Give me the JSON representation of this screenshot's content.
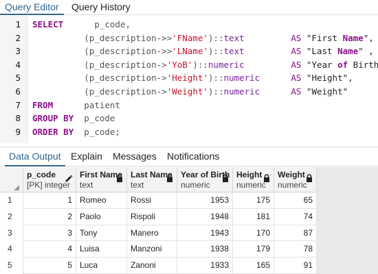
{
  "top_tabs": [
    {
      "label": "Query Editor",
      "active": true
    },
    {
      "label": "Query History",
      "active": false
    }
  ],
  "editor": {
    "line_numbers": [
      "1",
      "2",
      "3",
      "4",
      "5",
      "6",
      "7",
      "8",
      "9"
    ],
    "lines": [
      {
        "kw": "SELECT",
        "rest": "p_code,"
      },
      {
        "expr_open": "(p_description->>",
        "key": "'FName'",
        "expr_close": ")::",
        "type": "text",
        "as": "AS",
        "alias_pre": "\"First ",
        "alias_kw": "Name",
        "alias_post": "\","
      },
      {
        "expr_open": "(p_description->>",
        "key": "'LName'",
        "expr_close": ")::",
        "type": "text",
        "as": "AS",
        "alias_pre": "\"Last ",
        "alias_kw": "Name",
        "alias_post": "\" ,"
      },
      {
        "expr_open": "(p_description->",
        "key": "'YoB'",
        "expr_close": ")::",
        "type": "numeric",
        "as": "AS",
        "alias_pre": "\"Year ",
        "alias_kw": "of",
        "alias_post": " Birth\","
      },
      {
        "expr_open": "(p_description->",
        "key": "'Height'",
        "expr_close": ")::",
        "type": "numeric",
        "as": "AS",
        "alias_pre": "\"Height\",",
        "alias_kw": "",
        "alias_post": ""
      },
      {
        "expr_open": "(p_description->",
        "key": "'Weight'",
        "expr_close": ")::",
        "type": "numeric",
        "as": "AS",
        "alias_pre": "\"Weight\"",
        "alias_kw": "",
        "alias_post": ""
      },
      {
        "kw": "FROM",
        "rest": "patient"
      },
      {
        "kw": "GROUP BY",
        "rest": "p_code"
      },
      {
        "kw": "ORDER BY",
        "rest": "p_code;"
      }
    ]
  },
  "output_tabs": [
    {
      "label": "Data Output",
      "active": true
    },
    {
      "label": "Explain",
      "active": false
    },
    {
      "label": "Messages",
      "active": false
    },
    {
      "label": "Notifications",
      "active": false
    }
  ],
  "grid": {
    "columns": [
      {
        "name": "p_code",
        "type": "[PK] integer",
        "icon": "pencil-icon"
      },
      {
        "name": "First Name",
        "type": "text",
        "icon": "lock-icon"
      },
      {
        "name": "Last Name",
        "type": "text",
        "icon": "lock-icon"
      },
      {
        "name": "Year of Birth",
        "type": "numeric",
        "icon": "lock-icon"
      },
      {
        "name": "Height",
        "type": "numeric",
        "icon": "lock-icon"
      },
      {
        "name": "Weight",
        "type": "numeric",
        "icon": "lock-icon"
      }
    ],
    "rows": [
      {
        "n": "1",
        "cells": [
          "1",
          "Romeo",
          "Rossi",
          "1953",
          "175",
          "65"
        ]
      },
      {
        "n": "2",
        "cells": [
          "2",
          "Paolo",
          "Rispoli",
          "1948",
          "181",
          "74"
        ]
      },
      {
        "n": "3",
        "cells": [
          "3",
          "Tony",
          "Manero",
          "1943",
          "170",
          "87"
        ]
      },
      {
        "n": "4",
        "cells": [
          "4",
          "Luisa",
          "Manzoni",
          "1938",
          "179",
          "78"
        ]
      },
      {
        "n": "5",
        "cells": [
          "5",
          "Luca",
          "Zanoni",
          "1933",
          "165",
          "91"
        ]
      }
    ]
  }
}
